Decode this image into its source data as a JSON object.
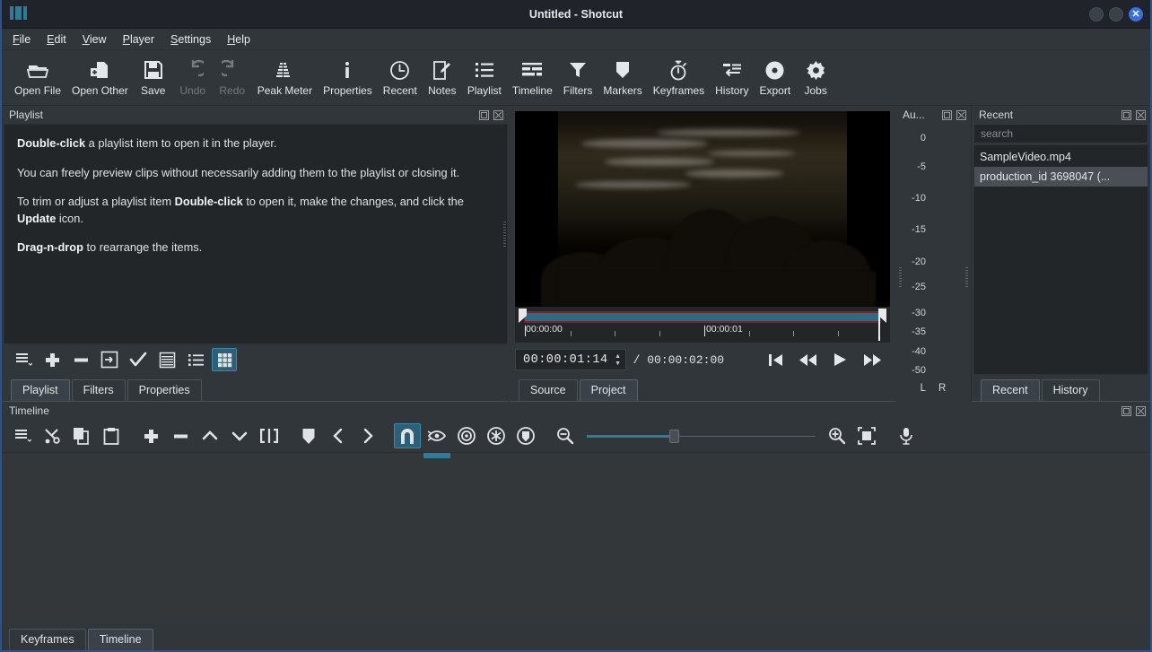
{
  "window": {
    "title": "Untitled - Shotcut",
    "logo_icon": "shotcut-logo-icon",
    "minimize_label": "",
    "maximize_label": "",
    "close_label": "✕"
  },
  "menubar": [
    {
      "label": "File",
      "mnemonic": "F",
      "rest": "ile"
    },
    {
      "label": "Edit",
      "mnemonic": "E",
      "rest": "dit"
    },
    {
      "label": "View",
      "mnemonic": "V",
      "rest": "iew"
    },
    {
      "label": "Player",
      "mnemonic": "P",
      "rest": "layer"
    },
    {
      "label": "Settings",
      "mnemonic": "S",
      "rest": "ettings"
    },
    {
      "label": "Help",
      "mnemonic": "H",
      "rest": "elp"
    }
  ],
  "toolbar": [
    {
      "label": "Open File",
      "icon": "folder-open-icon",
      "disabled": false
    },
    {
      "label": "Open Other",
      "icon": "open-other-icon",
      "disabled": false
    },
    {
      "label": "Save",
      "icon": "save-icon",
      "disabled": false
    },
    {
      "label": "Undo",
      "icon": "undo-icon",
      "disabled": true
    },
    {
      "label": "Redo",
      "icon": "redo-icon",
      "disabled": true
    },
    {
      "label": "Peak Meter",
      "icon": "peak-meter-icon",
      "disabled": false
    },
    {
      "label": "Properties",
      "icon": "info-icon",
      "disabled": false
    },
    {
      "label": "Recent",
      "icon": "clock-icon",
      "disabled": false
    },
    {
      "label": "Notes",
      "icon": "notes-icon",
      "disabled": false
    },
    {
      "label": "Playlist",
      "icon": "list-icon",
      "disabled": false
    },
    {
      "label": "Timeline",
      "icon": "timeline-icon",
      "disabled": false
    },
    {
      "label": "Filters",
      "icon": "funnel-icon",
      "disabled": false
    },
    {
      "label": "Markers",
      "icon": "marker-icon",
      "disabled": false
    },
    {
      "label": "Keyframes",
      "icon": "stopwatch-icon",
      "disabled": false
    },
    {
      "label": "History",
      "icon": "history-icon",
      "disabled": false
    },
    {
      "label": "Export",
      "icon": "export-disc-icon",
      "disabled": false
    },
    {
      "label": "Jobs",
      "icon": "gear-icon",
      "disabled": false
    }
  ],
  "playlist": {
    "title": "Playlist",
    "float_icon": "float-panel-icon",
    "close_icon": "close-panel-icon",
    "hints": [
      {
        "bold1": "Double-click",
        "text1": " a playlist item to open it in the player.",
        "bold2": "",
        "text2": ""
      },
      {
        "bold1": "",
        "text1": "You can freely preview clips without necessarily adding them to the playlist or closing it.",
        "bold2": "",
        "text2": ""
      },
      {
        "bold1": "",
        "text1": "To trim or adjust a playlist item ",
        "bold2": "Double-click",
        "text2": " to open it, make the changes, and click the ",
        "bold3": "Update",
        "text3": " icon."
      },
      {
        "bold1": "Drag-n-drop",
        "text1": " to rearrange the items.",
        "bold2": "",
        "text2": ""
      }
    ],
    "toolbar_buttons": [
      {
        "name": "playlist-menu-button",
        "icon": "hamburger-menu-icon",
        "active": false
      },
      {
        "name": "playlist-add-button",
        "icon": "plus-icon",
        "active": false
      },
      {
        "name": "playlist-remove-button",
        "icon": "minus-icon",
        "active": false
      },
      {
        "name": "playlist-update-button",
        "icon": "update-arrow-icon",
        "active": false
      },
      {
        "name": "playlist-check-button",
        "icon": "checkmark-icon",
        "active": false
      },
      {
        "name": "playlist-detail-view-button",
        "icon": "table-view-icon",
        "active": false
      },
      {
        "name": "playlist-list-view-button",
        "icon": "list-view-icon",
        "active": false
      },
      {
        "name": "playlist-tiles-view-button",
        "icon": "grid-view-icon",
        "active": true
      }
    ],
    "tabs": [
      {
        "label": "Playlist",
        "selected": true
      },
      {
        "label": "Filters",
        "selected": false
      },
      {
        "label": "Properties",
        "selected": false
      }
    ]
  },
  "player": {
    "ruler_labels": [
      {
        "text": "00:00:00",
        "pos_pct": 0
      },
      {
        "text": "00:00:01",
        "pos_pct": 51
      }
    ],
    "current_time": "00:00:01:14",
    "total_time": "/ 00:00:02:00",
    "spin_up": "▲",
    "spin_down": "▼",
    "transport": [
      {
        "name": "skip-to-start-button",
        "icon": "skip-start-icon"
      },
      {
        "name": "rewind-button",
        "icon": "rewind-icon"
      },
      {
        "name": "play-button",
        "icon": "play-icon"
      },
      {
        "name": "fast-forward-button",
        "icon": "fast-forward-icon"
      }
    ],
    "tabs": [
      {
        "label": "Source",
        "selected": false
      },
      {
        "label": "Project",
        "selected": true
      }
    ]
  },
  "meter": {
    "title": "Au...",
    "float_icon": "float-panel-icon",
    "close_icon": "close-panel-icon",
    "scale": [
      "0",
      "-5",
      "-10",
      "-15",
      "-20",
      "-25",
      "-30",
      "-35",
      "-40",
      "-50"
    ],
    "channel_left": "L",
    "channel_right": "R"
  },
  "recent": {
    "title": "Recent",
    "float_icon": "float-panel-icon",
    "close_icon": "close-panel-icon",
    "search_placeholder": "search",
    "search_value": "",
    "items": [
      {
        "label": "SampleVideo.mp4",
        "selected": false
      },
      {
        "label": "production_id 3698047 (...",
        "selected": true
      }
    ],
    "tabs": [
      {
        "label": "Recent",
        "selected": true
      },
      {
        "label": "History",
        "selected": false
      }
    ]
  },
  "timeline": {
    "title": "Timeline",
    "float_icon": "float-panel-icon",
    "close_icon": "close-panel-icon",
    "buttons": [
      {
        "name": "timeline-menu-button",
        "icon": "hamburger-menu-icon",
        "active": false
      },
      {
        "name": "cut-button",
        "icon": "scissors-icon",
        "active": false
      },
      {
        "name": "copy-button",
        "icon": "copy-icon",
        "active": false
      },
      {
        "name": "paste-button",
        "icon": "clipboard-icon",
        "active": false
      },
      {
        "name": "append-button",
        "icon": "plus-icon",
        "active": false
      },
      {
        "name": "ripple-delete-button",
        "icon": "minus-icon",
        "active": false
      },
      {
        "name": "lift-button",
        "icon": "chevron-up-icon",
        "active": false
      },
      {
        "name": "overwrite-button",
        "icon": "chevron-down-icon",
        "active": false
      },
      {
        "name": "split-button",
        "icon": "split-icon",
        "active": false
      },
      {
        "name": "marker-button",
        "icon": "marker-icon",
        "active": false
      },
      {
        "name": "previous-marker-button",
        "icon": "chevron-left-icon",
        "active": false
      },
      {
        "name": "next-marker-button",
        "icon": "chevron-right-icon",
        "active": false
      },
      {
        "name": "snap-button",
        "icon": "magnet-icon",
        "active": true
      },
      {
        "name": "scrub-while-dragging-button",
        "icon": "scrub-eye-icon",
        "active": false
      },
      {
        "name": "ripple-button",
        "icon": "ripple-target-icon",
        "active": false
      },
      {
        "name": "ripple-all-tracks-button",
        "icon": "ripple-all-icon",
        "active": false
      },
      {
        "name": "ripple-markers-button",
        "icon": "ripple-markers-icon",
        "active": false
      },
      {
        "name": "zoom-out-button",
        "icon": "zoom-out-icon",
        "active": false
      },
      {
        "name": "zoom-in-button",
        "icon": "zoom-in-icon",
        "active": false
      },
      {
        "name": "zoom-fit-button",
        "icon": "zoom-fit-icon",
        "active": false
      },
      {
        "name": "record-audio-button",
        "icon": "microphone-icon",
        "active": false
      }
    ],
    "zoom_level_pct": 38,
    "tabs": [
      {
        "label": "Keyframes",
        "selected": false
      },
      {
        "label": "Timeline",
        "selected": true
      }
    ]
  },
  "colors": {
    "window_bg": "#31363b",
    "panel_bg": "#232629",
    "accent": "#2d7d9a",
    "accent_selected": "#2d5f77",
    "title_bar": "#20242a",
    "close_button": "#3b6fe0",
    "scrub_fill": "#2c6b86",
    "scrub_track": "#7a2431",
    "text": "#e4e7ea",
    "text_disabled": "#75797e"
  }
}
